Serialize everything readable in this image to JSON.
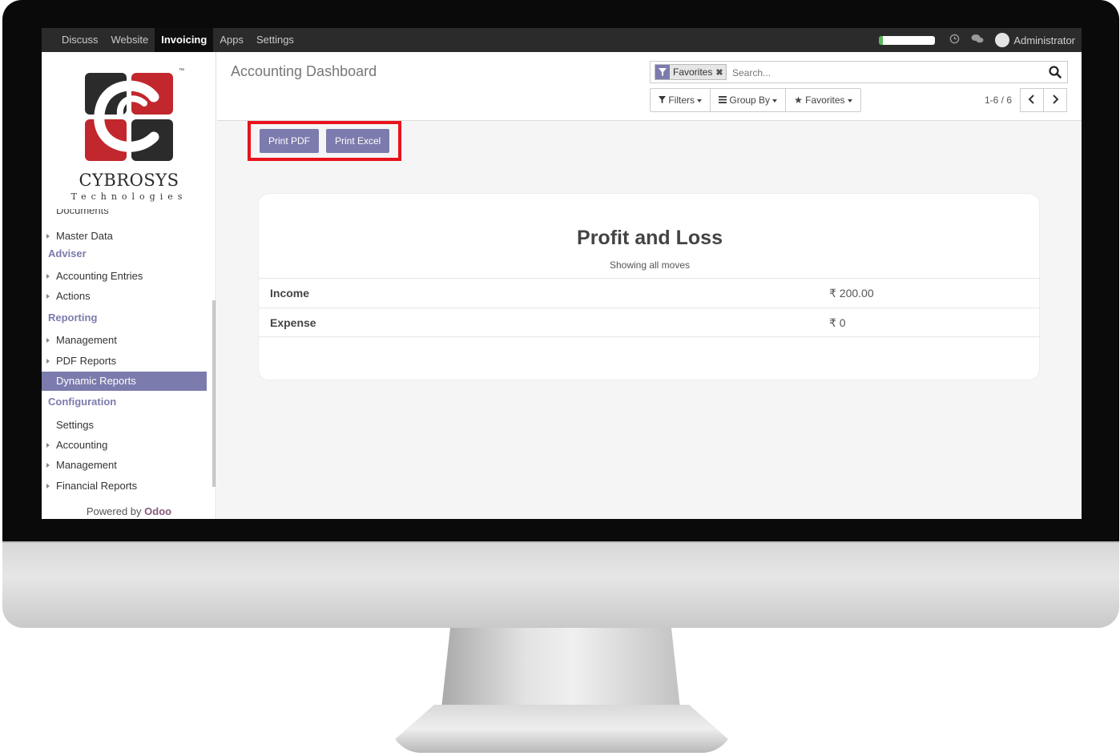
{
  "topbar": {
    "nav": [
      "Discuss",
      "Website",
      "Invoicing",
      "Apps",
      "Settings"
    ],
    "active": "Invoicing",
    "user": "Administrator"
  },
  "logo": {
    "name": "CYBROSYS",
    "sub": "Technologies",
    "tm": "™",
    "colors": {
      "red": "#c1272d",
      "dark": "#2b2b2b"
    }
  },
  "sidebar": {
    "cut_item": "Documents",
    "items": [
      {
        "type": "item",
        "label": "Master Data",
        "caret": true
      },
      {
        "type": "section",
        "label": "Adviser"
      },
      {
        "type": "item",
        "label": "Accounting Entries",
        "caret": true
      },
      {
        "type": "item",
        "label": "Actions",
        "caret": true
      },
      {
        "type": "section",
        "label": "Reporting"
      },
      {
        "type": "item",
        "label": "Management",
        "caret": true
      },
      {
        "type": "item",
        "label": "PDF Reports",
        "caret": true
      },
      {
        "type": "item",
        "label": "Dynamic Reports",
        "caret": false,
        "active": true
      },
      {
        "type": "section",
        "label": "Configuration"
      },
      {
        "type": "item",
        "label": "Settings",
        "caret": false
      },
      {
        "type": "item",
        "label": "Accounting",
        "caret": true
      },
      {
        "type": "item",
        "label": "Management",
        "caret": true
      },
      {
        "type": "item",
        "label": "Financial Reports",
        "caret": true
      }
    ],
    "powered_by": "Powered by",
    "powered_brand": "Odoo"
  },
  "control_panel": {
    "title": "Accounting Dashboard",
    "search": {
      "facet": "Favorites",
      "placeholder": "Search..."
    },
    "filters_label": "Filters",
    "groupby_label": "Group By",
    "favorites_label": "Favorites",
    "pager": "1-6 / 6"
  },
  "actions": {
    "print_pdf": "Print PDF",
    "print_excel": "Print Excel"
  },
  "report": {
    "title": "Profit and Loss",
    "subtitle": "Showing all moves",
    "rows": [
      {
        "label": "Income",
        "value": "₹ 200.00"
      },
      {
        "label": "Expense",
        "value": "₹ 0"
      }
    ]
  },
  "colors": {
    "accent": "#7c7bad",
    "highlight": "#e8131b",
    "odoo": "#875a7b"
  }
}
